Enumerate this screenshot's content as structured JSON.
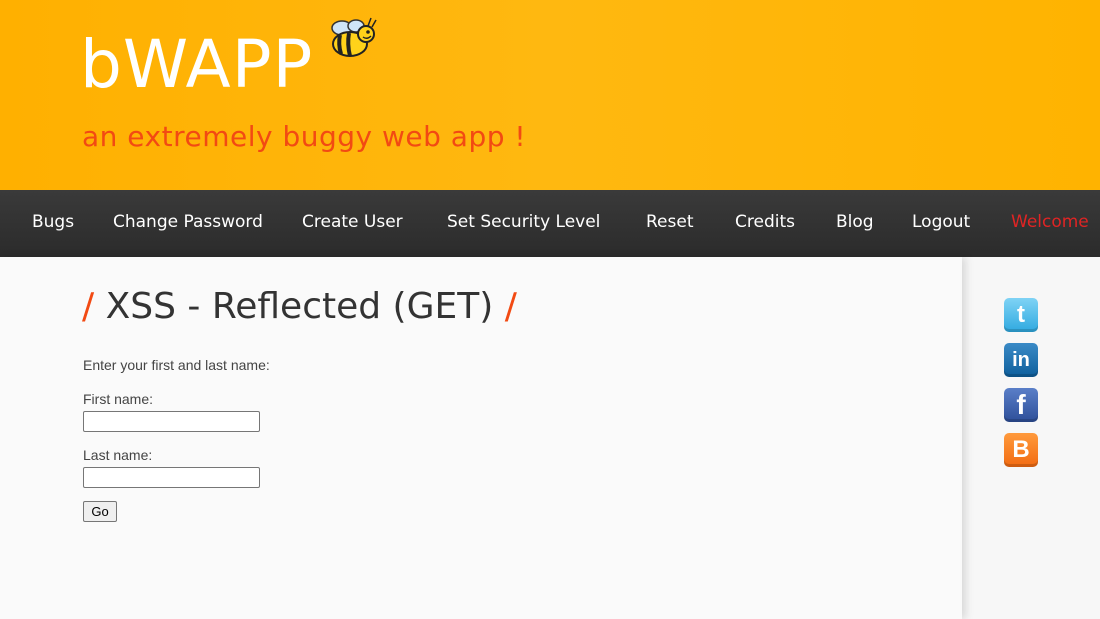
{
  "header": {
    "logo": "bWAPP",
    "tagline": "an extremely buggy web app !"
  },
  "nav": {
    "items": [
      {
        "label": "Bugs"
      },
      {
        "label": "Change Password"
      },
      {
        "label": "Create User"
      },
      {
        "label": "Set Security Level"
      },
      {
        "label": "Reset"
      },
      {
        "label": "Credits"
      },
      {
        "label": "Blog"
      },
      {
        "label": "Logout"
      }
    ],
    "welcome": "Welcome"
  },
  "main": {
    "title_slash_left": "/",
    "title": "XSS - Reflected (GET)",
    "title_slash_right": "/",
    "instructions": "Enter your first and last name:",
    "first_name_label": "First name:",
    "first_name_value": "",
    "last_name_label": "Last name:",
    "last_name_value": "",
    "go_label": "Go"
  },
  "social": {
    "twitter": "t",
    "linkedin": "in",
    "facebook": "f",
    "blogger": "B"
  },
  "colors": {
    "header_bg": "#ffb300",
    "tagline": "#f24a13",
    "nav_bg": "#2f2f2f",
    "welcome": "#e02424",
    "accent_slash": "#f24a13"
  }
}
